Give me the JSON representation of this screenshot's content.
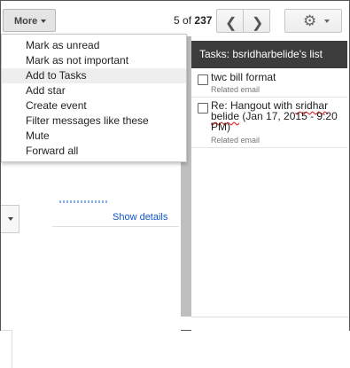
{
  "toolbar": {
    "more_label": "More",
    "pager": {
      "start": "5",
      "of": "of",
      "total": "237"
    },
    "prev_glyph": "❮",
    "next_glyph": "❯",
    "gear_glyph": "⚙"
  },
  "more_menu": {
    "items": [
      {
        "label": "Mark as unread"
      },
      {
        "label": "Mark as not important"
      },
      {
        "label": "Add to Tasks",
        "highlighted": true
      },
      {
        "label": "Add star"
      },
      {
        "label": "Create event"
      },
      {
        "label": "Filter messages like these"
      },
      {
        "label": "Mute"
      },
      {
        "label": "Forward all"
      }
    ]
  },
  "message": {
    "show_details": "Show details"
  },
  "tasks": {
    "header": "Tasks: bsridharbelide's list",
    "items": [
      {
        "title": "twc bill format",
        "related": "Related email"
      },
      {
        "title_a": "Re: Hangout with ",
        "title_b": "sridhar belide",
        "title_c": " (Jan 17, 2015 - 9:20 PM)",
        "related": "Related email"
      }
    ]
  },
  "colors": {
    "tasks_header_bg": "#3c3c3c",
    "link": "#1155cc",
    "menu_highlight": "#eeeeee"
  }
}
